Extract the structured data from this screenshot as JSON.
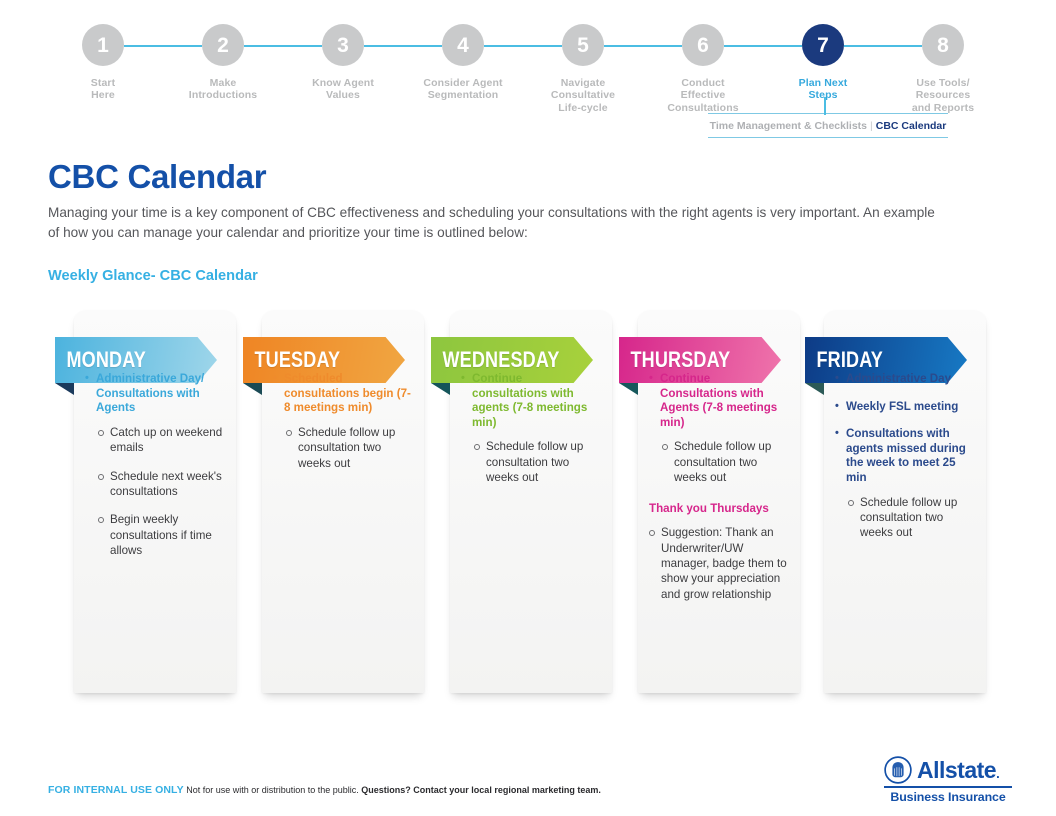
{
  "stepper": {
    "steps": [
      {
        "number": "1",
        "label": "Start\nHere",
        "active": false
      },
      {
        "number": "2",
        "label": "Make\nIntroductions",
        "active": false
      },
      {
        "number": "3",
        "label": "Know Agent\nValues",
        "active": false
      },
      {
        "number": "4",
        "label": "Consider Agent\nSegmentation",
        "active": false
      },
      {
        "number": "5",
        "label": "Navigate\nConsultative\nLife-cycle",
        "active": false
      },
      {
        "number": "6",
        "label": "Conduct\nEffective\nConsultations",
        "active": false
      },
      {
        "number": "7",
        "label": "Plan Next\nSteps",
        "active": true
      },
      {
        "number": "8",
        "label": "Use Tools/\nResources\nand Reports",
        "active": false
      }
    ],
    "subcrumb": {
      "previous": "Time Management & Checklists",
      "separator": "|",
      "current": "CBC Calendar"
    }
  },
  "page": {
    "title": "CBC Calendar",
    "intro": "Managing your time is a key component of CBC effectiveness and scheduling your consultations with the right agents is very important. An example of how you can manage your calendar and prioritize your time is outlined below:",
    "section_heading": "Weekly Glance- CBC Calendar"
  },
  "colors": {
    "brand_navy": "#1450a8",
    "accent_cyan": "#36b0e3",
    "step_active": "#1b3a7e",
    "step_inactive": "#c9cacb",
    "connector": "#4bbde3"
  },
  "days": [
    {
      "name": "MONDAY",
      "ribbon_from": "#4cb3de",
      "ribbon_to": "#9fd6ea",
      "fold": "#1b3a5c",
      "text_color": "#3aa8da",
      "items": [
        {
          "text": "Administrative Day/ Consultations with Agents",
          "bullet": true,
          "sub": [
            "Catch up on weekend emails",
            "Schedule next week's consultations",
            "Begin weekly consultations if time allows"
          ]
        }
      ]
    },
    {
      "name": "TUESDAY",
      "ribbon_from": "#ef8524",
      "ribbon_to": "#f0a642",
      "fold": "#1b4a55",
      "text_color": "#ef8b2c",
      "items": [
        {
          "text": "Scheduled consultations begin (7-8 meetings min)",
          "bullet": true,
          "sub": [
            "Schedule follow up consultation two weeks out"
          ]
        }
      ]
    },
    {
      "name": "WEDNESDAY",
      "ribbon_from": "#8dc63f",
      "ribbon_to": "#a8d13b",
      "fold": "#15555a",
      "text_color": "#7eb92f",
      "items": [
        {
          "text": "Continue consultations with agents (7-8 meetings min)",
          "bullet": true,
          "sub": [
            "Schedule follow up consultation two weeks out"
          ]
        }
      ]
    },
    {
      "name": "THURSDAY",
      "ribbon_from": "#d6268b",
      "ribbon_to": "#ef74ab",
      "fold": "#17585c",
      "text_color": "#d6268b",
      "items": [
        {
          "text": "Continue Consultations with Agents (7-8 meetings min)",
          "bullet": true,
          "sub": [
            "Schedule follow up consultation two weeks out"
          ]
        },
        {
          "text": "Thank you Thursdays",
          "bullet": false,
          "sub": [
            "Suggestion: Thank an Underwriter/UW manager, badge them to show your appreciation and grow relationship"
          ]
        }
      ]
    },
    {
      "name": "FRIDAY",
      "ribbon_from": "#0d3b86",
      "ribbon_to": "#1779c4",
      "fold": "#2c5a57",
      "text_color": "#2b4a8c",
      "items": [
        {
          "text": "Administrative Day",
          "bullet": true,
          "sub": []
        },
        {
          "text": "Weekly FSL meeting",
          "bullet": true,
          "sub": []
        },
        {
          "text": "Consultations with agents missed during the week to meet 25 min",
          "bullet": true,
          "sub": [
            "Schedule follow up consultation two weeks out"
          ]
        }
      ]
    }
  ],
  "footer": {
    "highlight": "FOR INTERNAL USE ONLY",
    "text": " Not for use with or distribution to the public. ",
    "question": "Questions? Contact your local regional marketing team."
  },
  "logo": {
    "wordmark": "Allstate",
    "trademark": ".",
    "subtitle": "Business Insurance",
    "mark_name": "allstate-hands-icon"
  }
}
